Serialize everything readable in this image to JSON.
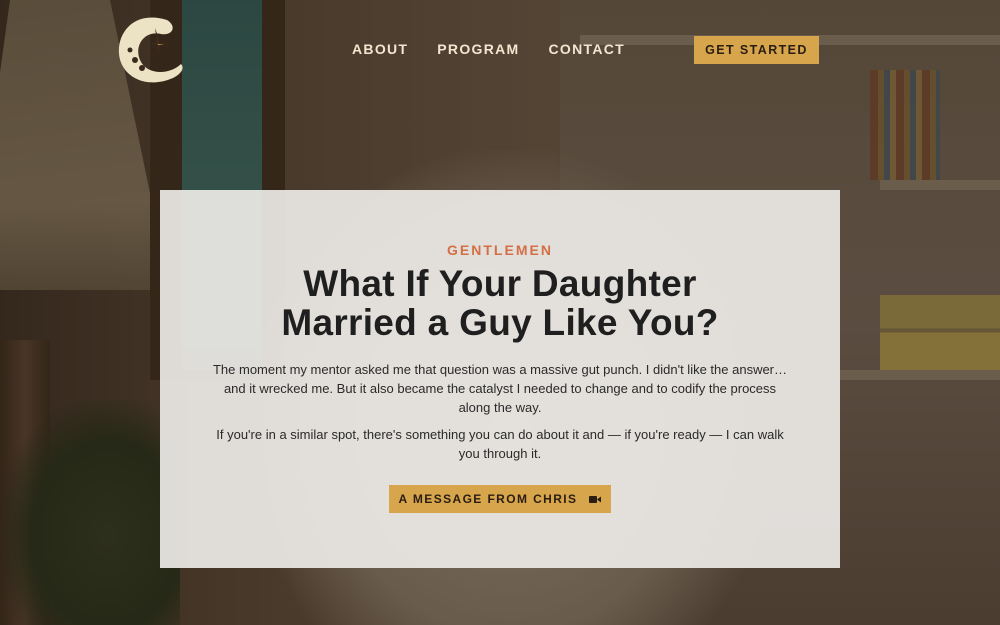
{
  "header": {
    "logo_icon": "crescent-c-logo-icon",
    "nav": [
      {
        "label": "ABOUT"
      },
      {
        "label": "PROGRAM"
      },
      {
        "label": "CONTACT"
      }
    ],
    "cta_label": "GET STARTED"
  },
  "hero": {
    "eyebrow": "GENTLEMEN",
    "headline_line1": "What If Your Daughter",
    "headline_line2": "Married a Guy Like You?",
    "paragraph1": "The moment my mentor asked me that question was a massive gut punch. I didn't like the answer… and it wrecked me. But it also became the catalyst I needed to change and to codify the process along the way.",
    "paragraph2": "If you're in a similar spot, there's something you can do about it and — if you're ready — I can walk you through it.",
    "button_label": "A MESSAGE FROM CHRIS",
    "button_icon": "video-camera-icon"
  },
  "colors": {
    "accent": "#d7a54c",
    "eyebrow": "#d46f45",
    "nav_text": "#f1e6cf",
    "card_bg": "#ece9e6"
  }
}
